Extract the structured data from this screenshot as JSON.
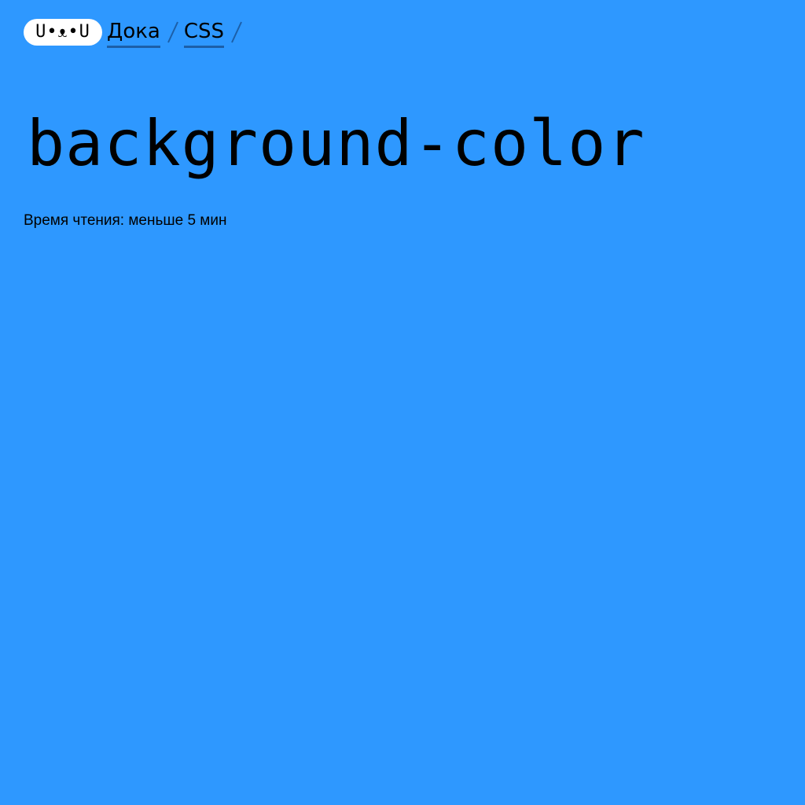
{
  "page": {
    "background_color": "#2e98ff",
    "underline_color": "#1c5fa8"
  },
  "header": {
    "logo": {
      "text": "U•ᴥ•U",
      "icon": "doka-logo-icon"
    },
    "breadcrumbs": [
      {
        "label": "Дока"
      },
      {
        "label": "CSS"
      }
    ],
    "separator_icon": "slash-separator-icon"
  },
  "article": {
    "title": "background-color",
    "reading_time": "Время чтения: меньше 5 мин"
  }
}
